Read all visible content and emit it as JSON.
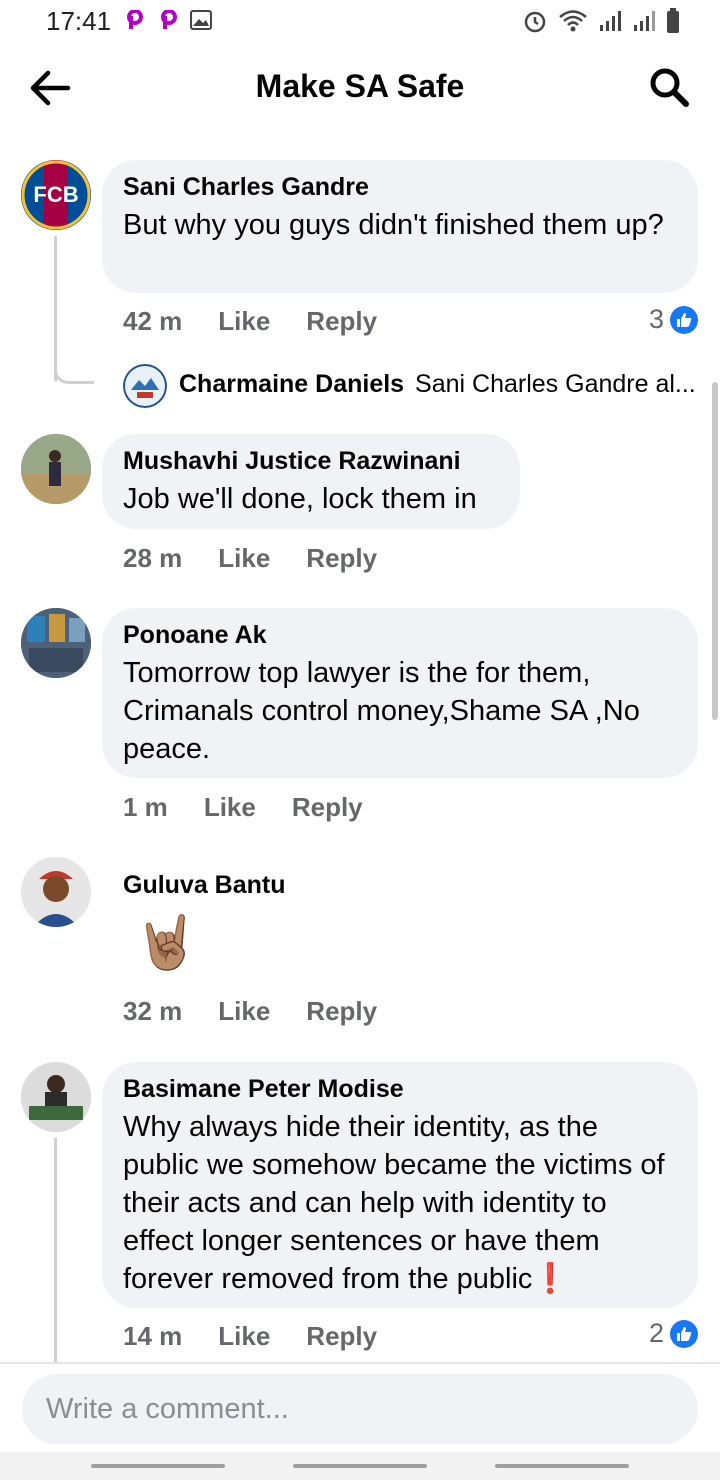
{
  "status_bar": {
    "time": "17:41"
  },
  "header": {
    "title": "Make SA Safe"
  },
  "comments": [
    {
      "author": "Sani Charles Gandre",
      "text": "But why you guys didn't finished them up?",
      "time": "42 m",
      "like": "Like",
      "reply": "Reply",
      "likes": "3",
      "avatar_text": "FCB"
    },
    {
      "author": "Mushavhi Justice Razwinani",
      "text": "Job we'll done, lock them in",
      "time": "28 m",
      "like": "Like",
      "reply": "Reply"
    },
    {
      "author": "Ponoane Ak",
      "text": "Tomorrow top lawyer is the for them, Crimanals control money,Shame  SA ,No peace.",
      "time": "1 m",
      "like": "Like",
      "reply": "Reply"
    },
    {
      "author": "Guluva Bantu",
      "text": "🤘🏽",
      "time": "32 m",
      "like": "Like",
      "reply": "Reply"
    },
    {
      "author": "Basimane Peter Modise",
      "text": "Why always hide their identity, as the public we somehow became the victims of their acts and can help with identity to effect longer sentences or have them forever removed from the public",
      "emoji": "❗",
      "time": "14 m",
      "like": "Like",
      "reply": "Reply",
      "likes": "2"
    }
  ],
  "reply_preview": {
    "author": "Charmaine Daniels",
    "text": "Sani Charles Gandre al..."
  },
  "composer": {
    "placeholder": "Write a comment..."
  },
  "colors": {
    "accent": "#1877f2",
    "bubble": "#f0f2f5",
    "meta": "#65676b"
  }
}
